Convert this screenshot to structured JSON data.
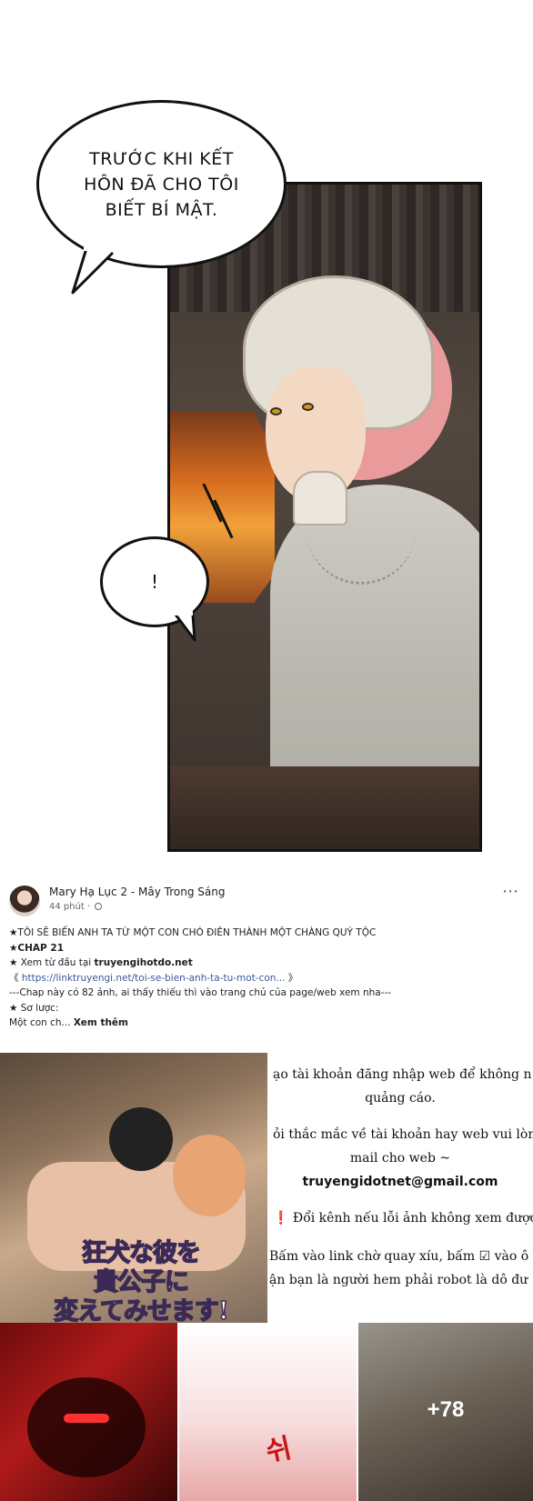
{
  "comic": {
    "bubble_main": "TRƯỚC KHI KẾT\nHÔN ĐÃ CHO TÔI\nBIẾT BÍ MẬT.",
    "bubble_small": "!"
  },
  "post": {
    "author": "Mary Hạ Lục 2 - Mây Trong Sáng",
    "time": "44 phút ·",
    "more_icon": "⋯",
    "lines": {
      "title": "★TÔI SẼ BIẾN ANH TA TỪ MỘT CON CHÓ ĐIÊN THÀNH MỘT CHÀNG QUÝ TỘC",
      "chapter": "★CHAP 21",
      "read_prefix": "★ Xem từ đầu tại ",
      "read_site": "truyengihotdo.net",
      "link_open": "《 ",
      "link_url": "https://linktruyengi.net/toi-se-bien-anh-ta-tu-mot-con...",
      "link_close": " 》",
      "note": "---Chap này có 82 ảnh, ai thấy thiếu thì vào trang chủ của page/web xem nha---",
      "summary_label": "★ Sơ lược:",
      "summary_text": "Một con ch... ",
      "see_more": "Xem thêm"
    }
  },
  "media": {
    "cover_title": "狂犬な彼を\n貴公子に\n変えてみせます!",
    "notice": {
      "l1": "ạo tài khoản đăng nhập web để không n",
      "l2": "quảng cáo.",
      "l3": "ỏi thắc mắc về tài khoản hay web vui lòn",
      "l4": "mail cho web ~",
      "l5": "truyengidotnet@gmail.com",
      "l6_icon": "❗",
      "l6": " Đổi kênh nếu lỗi ảnh không xem được",
      "l7": "Bấm vào link chờ quay xíu, bấm ☑ vào ô",
      "l8": "ận bạn là người hem phải robot là dô đư"
    },
    "thumb2_sfx": "쉬",
    "more_count": "+78"
  }
}
